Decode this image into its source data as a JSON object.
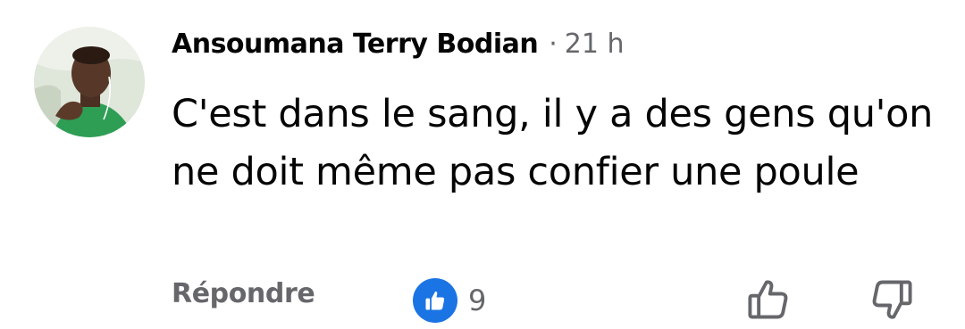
{
  "comment": {
    "author": "Ansoumana Terry Bodian",
    "separator": "·",
    "time": "21 h",
    "text": "C'est dans le sang, il y a des gens qu'on ne doit même pas confier une poule"
  },
  "actions": {
    "reply_label": "Répondre",
    "reaction_count": "9",
    "reaction_type": "like-icon"
  },
  "colors": {
    "text": "#050505",
    "secondary": "#65676b",
    "like_blue": "#1b74e4"
  }
}
